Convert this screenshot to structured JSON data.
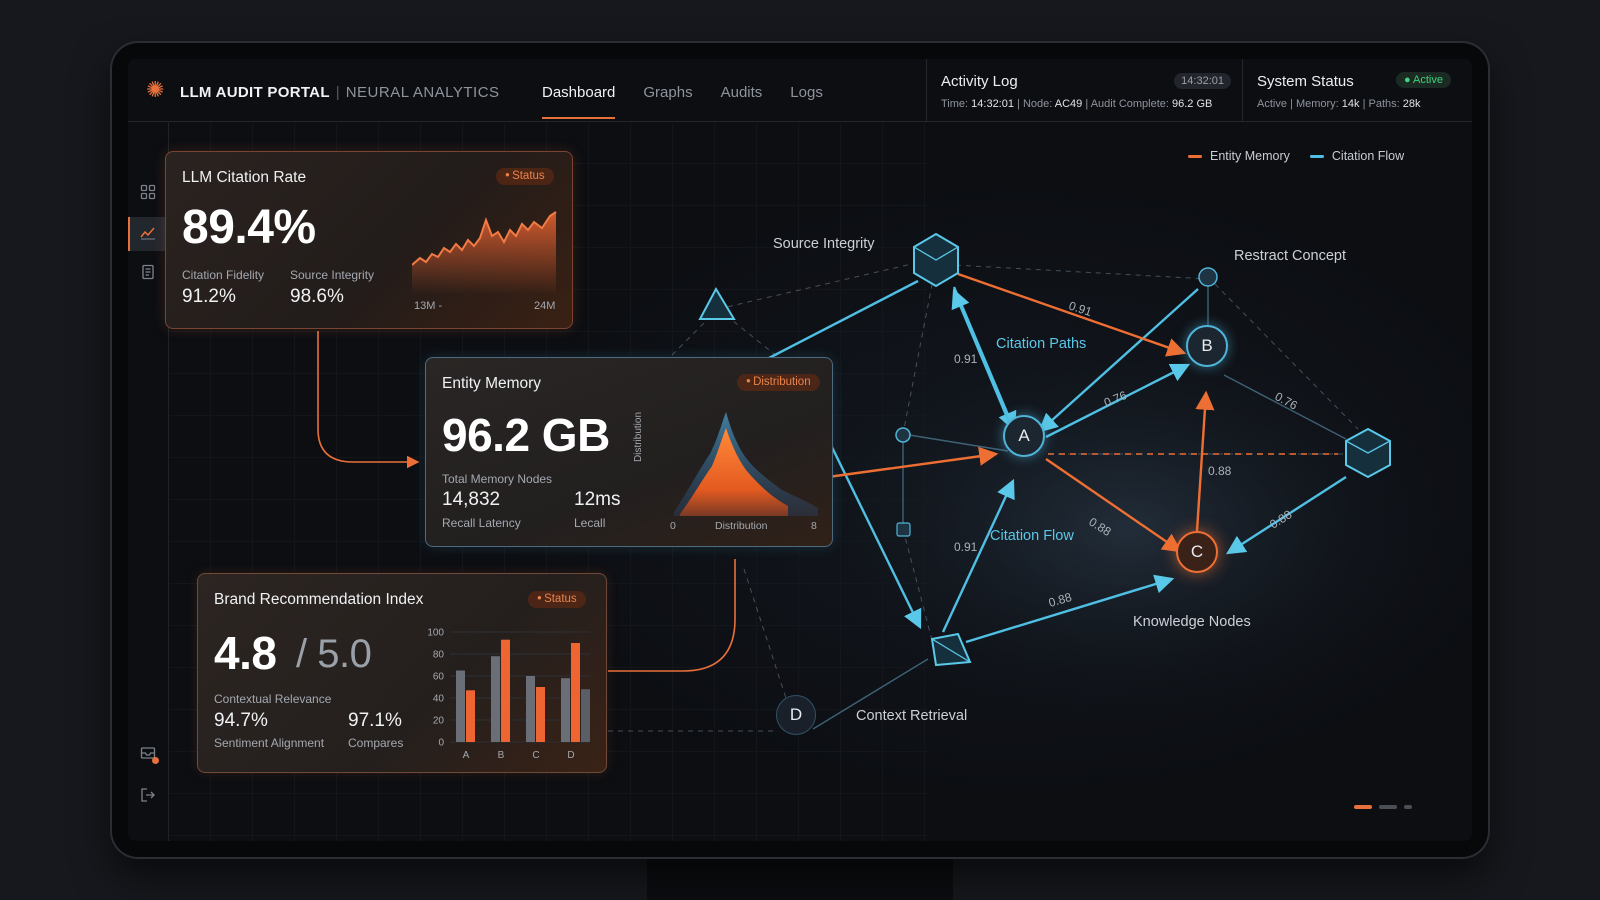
{
  "header": {
    "app_title": "LLM AUDIT PORTAL",
    "app_subtitle": "NEURAL ANALYTICS",
    "nav": [
      "Dashboard",
      "Graphs",
      "Audits",
      "Logs"
    ],
    "activity": {
      "title": "Activity Log",
      "time_badge": "14:32:01",
      "time_label": "Time:",
      "time_value": "14:32:01",
      "node_label": "Node:",
      "node_value": "AC49",
      "audit_label": "Audit Complete:",
      "audit_value": "96.2 GB"
    },
    "system": {
      "title": "System Status",
      "badge": "Active",
      "status": "Active",
      "memory_label": "Memory:",
      "memory_value": "14k",
      "paths_label": "Paths:",
      "paths_value": "28k"
    }
  },
  "legend": {
    "entity_memory": "Entity Memory",
    "citation_flow": "Citation Flow"
  },
  "colors": {
    "accent_orange": "#e8703a",
    "accent_cyan": "#4fb4d8",
    "status_green": "#3fd27a"
  },
  "sidebar": {
    "icons": [
      "grid-icon",
      "chart-line-icon",
      "document-icon",
      "inbox-icon",
      "logout-icon"
    ]
  },
  "network": {
    "labels": {
      "source_integrity": "Source Integrity",
      "restract_concept": "Restract Concept",
      "citation_paths": "Citation Paths",
      "citation_flow": "Citation Flow",
      "knowledge_nodes": "Knowledge Nodes",
      "context_retrieval": "Context Retrieval"
    },
    "nodes": {
      "a": "A",
      "b": "B",
      "c": "C",
      "d": "D"
    },
    "weights": [
      "0.91",
      "0.91",
      "0.76",
      "0.76",
      "0.88",
      "0.88",
      "0.91",
      "0.88",
      "0.88"
    ]
  },
  "citation_card": {
    "title": "LLM Citation Rate",
    "badge": "Status",
    "value": "89.4%",
    "metric1_label": "Citation Fidelity",
    "metric1_value": "91.2%",
    "metric2_label": "Source Integrity",
    "metric2_value": "98.6%",
    "spark_start": "13M -",
    "spark_end": "24M"
  },
  "memory_card": {
    "title": "Entity Memory",
    "badge": "Distribution",
    "value": "96.2 GB",
    "nodes_label": "Total Memory Nodes",
    "nodes_value": "14,832",
    "nodes_sub": "Recall Latency",
    "latency_value": "12ms",
    "latency_sub": "Lecall",
    "dist_ylabel": "Distribution",
    "dist_xlabel": "Distribution",
    "dist_xmin": "0",
    "dist_xmax": "8"
  },
  "brand_card": {
    "title": "Brand Recommendation Index",
    "badge": "Status",
    "value": "4.8",
    "value_max": "/ 5.0",
    "relevance_label": "Contextual Relevance",
    "relevance_value": "94.7%",
    "relevance_sub": "Sentiment Alignment",
    "compares_value": "97.1%",
    "compares_sub": "Compares"
  },
  "chart_data": {
    "type": "bar",
    "categories": [
      "A",
      "B",
      "C",
      "D"
    ],
    "yticks": [
      "100",
      "80",
      "60",
      "40",
      "20",
      "0"
    ],
    "ylim": [
      0,
      100
    ],
    "series": [
      {
        "values": [
          65,
          78,
          60,
          58
        ]
      },
      {
        "values": [
          47,
          93,
          50,
          90
        ]
      },
      {
        "values": [
          0,
          0,
          0,
          48
        ]
      }
    ],
    "series_colors": [
      "#6a6e76",
      "#ee6532",
      "#5a5e66"
    ]
  }
}
